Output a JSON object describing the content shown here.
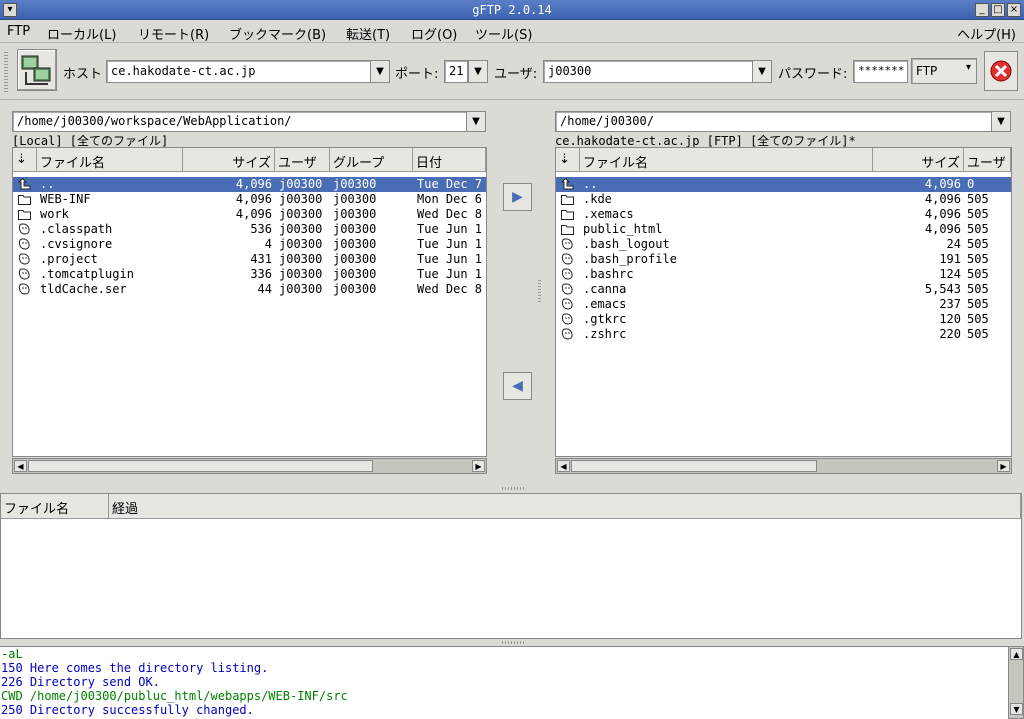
{
  "window": {
    "title": "gFTP 2.0.14"
  },
  "menu": [
    "FTP",
    "ローカル(L)",
    "リモート(R)",
    "ブックマーク(B)",
    "転送(T)",
    "ログ(O)",
    "ツール(S)",
    "ヘルプ(H)"
  ],
  "toolbar": {
    "host_label": "ホスト",
    "host": "ce.hakodate-ct.ac.jp",
    "port_label": "ポート:",
    "port": "21",
    "user_label": "ユーザ:",
    "user": "j00300",
    "password_label": "パスワード:",
    "password": "*******",
    "protocol": "FTP"
  },
  "local": {
    "path": "/home/j00300/workspace/WebApplication/",
    "status": "[Local] [全てのファイル]",
    "columns": {
      "name": "ファイル名",
      "size": "サイズ",
      "user": "ユーザ",
      "group": "グループ",
      "date": "日付"
    },
    "files": [
      {
        "name": "..",
        "size": "4,096",
        "user": "j00300",
        "group": "j00300",
        "date": "Tue Dec 7",
        "type": "up"
      },
      {
        "name": "WEB-INF",
        "size": "4,096",
        "user": "j00300",
        "group": "j00300",
        "date": "Mon Dec 6",
        "type": "folder"
      },
      {
        "name": "work",
        "size": "4,096",
        "user": "j00300",
        "group": "j00300",
        "date": "Wed Dec 8",
        "type": "folder"
      },
      {
        "name": ".classpath",
        "size": "536",
        "user": "j00300",
        "group": "j00300",
        "date": "Tue Jun 1",
        "type": "file"
      },
      {
        "name": ".cvsignore",
        "size": "4",
        "user": "j00300",
        "group": "j00300",
        "date": "Tue Jun 1",
        "type": "file"
      },
      {
        "name": ".project",
        "size": "431",
        "user": "j00300",
        "group": "j00300",
        "date": "Tue Jun 1",
        "type": "file"
      },
      {
        "name": ".tomcatplugin",
        "size": "336",
        "user": "j00300",
        "group": "j00300",
        "date": "Tue Jun 1",
        "type": "file"
      },
      {
        "name": "tldCache.ser",
        "size": "44",
        "user": "j00300",
        "group": "j00300",
        "date": "Wed Dec 8",
        "type": "file"
      }
    ]
  },
  "remote": {
    "path": "/home/j00300/",
    "status": "ce.hakodate-ct.ac.jp [FTP] [全てのファイル]*",
    "columns": {
      "name": "ファイル名",
      "size": "サイズ",
      "user": "ユーザ"
    },
    "files": [
      {
        "name": "..",
        "size": "4,096",
        "user": "0",
        "type": "up"
      },
      {
        "name": ".kde",
        "size": "4,096",
        "user": "505",
        "type": "folder"
      },
      {
        "name": ".xemacs",
        "size": "4,096",
        "user": "505",
        "type": "folder"
      },
      {
        "name": "public_html",
        "size": "4,096",
        "user": "505",
        "type": "folder"
      },
      {
        "name": ".bash_logout",
        "size": "24",
        "user": "505",
        "type": "file"
      },
      {
        "name": ".bash_profile",
        "size": "191",
        "user": "505",
        "type": "file"
      },
      {
        "name": ".bashrc",
        "size": "124",
        "user": "505",
        "type": "file"
      },
      {
        "name": ".canna",
        "size": "5,543",
        "user": "505",
        "type": "file"
      },
      {
        "name": ".emacs",
        "size": "237",
        "user": "505",
        "type": "file"
      },
      {
        "name": ".gtkrc",
        "size": "120",
        "user": "505",
        "type": "file"
      },
      {
        "name": ".zshrc",
        "size": "220",
        "user": "505",
        "type": "file"
      }
    ]
  },
  "transfer": {
    "col_name": "ファイル名",
    "col_progress": "経過"
  },
  "log": [
    {
      "text": " -aL",
      "color": "#008000"
    },
    {
      "text": "150 Here comes the directory listing.",
      "color": "#0000c0"
    },
    {
      "text": "226 Directory send OK.",
      "color": "#0000c0"
    },
    {
      "text": "CWD /home/j00300/publuc_html/webapps/WEB-INF/src",
      "color": "#008000"
    },
    {
      "text": "250 Directory successfully changed.",
      "color": "#0000c0"
    }
  ]
}
